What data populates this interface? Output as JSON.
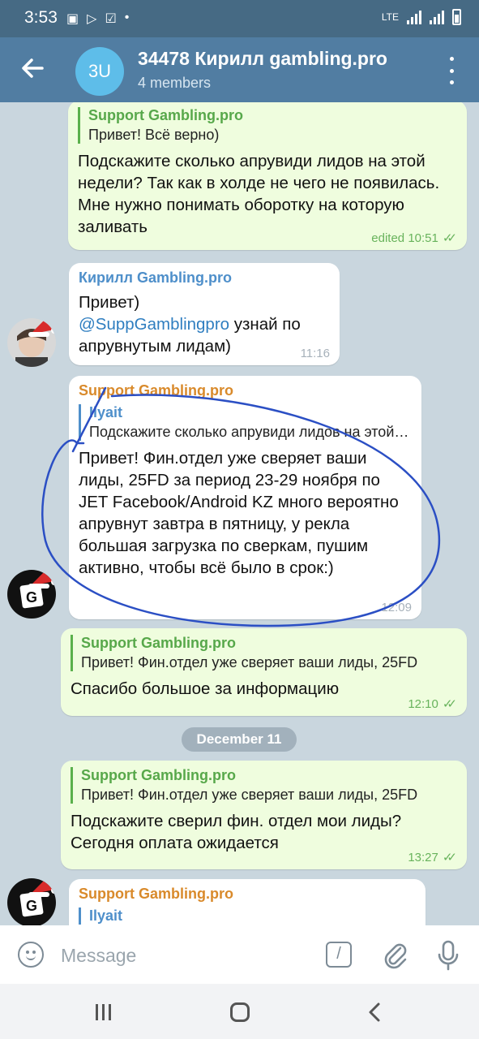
{
  "status_bar": {
    "time": "3:53",
    "network": "LTE",
    "icons": [
      "image-icon",
      "play-store-icon",
      "check-box-icon",
      "dot-icon"
    ]
  },
  "header": {
    "avatar_initials": "3U",
    "avatar_color": "#5ebde9",
    "title": "34478 Кирилл gambling.pro",
    "subtitle": "4 members"
  },
  "messages": [
    {
      "direction": "out",
      "reply_name": "Support Gambling.pro",
      "reply_text": "Привет! Всё верно)",
      "text": "Подскажите сколько апрувиди лидов  на этой недели? Так как в холде не чего не появилась. Мне нужно понимать оборотку на которую заливать",
      "time": "edited 10:51",
      "read": true
    },
    {
      "direction": "in",
      "sender": "Кирилл Gambling.pro",
      "text_line1": "Привет)",
      "link": "@SuppGamblingpro",
      "text_after_link": " узнай по апрувнутым лидам)",
      "time": "11:16"
    },
    {
      "direction": "in",
      "sender": "Support Gambling.pro",
      "reply_name": "Ilyait",
      "reply_text": "Подскажите сколько апрувиди лидов  на этой недели?",
      "text": "Привет! Фин.отдел уже сверяет ваши лиды, 25FD  за период 23-29 ноября по JET Facebook/Android KZ много вероятно апрувнут завтра в пятницу, у рекла большая загрузка по сверкам, пушим активно, чтобы всё было в срок:)",
      "time": "12:09"
    },
    {
      "direction": "out",
      "reply_name": "Support Gambling.pro",
      "reply_text": "Привет! Фин.отдел уже сверяет ваши лиды, 25FD",
      "text": "Спасибо большое за информацию",
      "time": "12:10",
      "read": true
    },
    {
      "direction": "out",
      "reply_name": "Support Gambling.pro",
      "reply_text": "Привет! Фин.отдел уже сверяет ваши лиды, 25FD",
      "text": "Подскажите сверил  фин. отдел мои лиды? Сегодня оплата ожидается",
      "time": "13:27",
      "read": true
    },
    {
      "direction": "in",
      "sender": "Support Gambling.pro",
      "reply_name": "Ilyait"
    }
  ],
  "date_separator": "December 11",
  "input": {
    "placeholder": "Message"
  },
  "colors": {
    "header": "#517da2",
    "status_bar": "#466a84",
    "chat_background": "#c9d6de",
    "outgoing_bubble": "#effdde",
    "incoming_bubble": "#ffffff",
    "annotation_ink": "#2b4fc4"
  }
}
